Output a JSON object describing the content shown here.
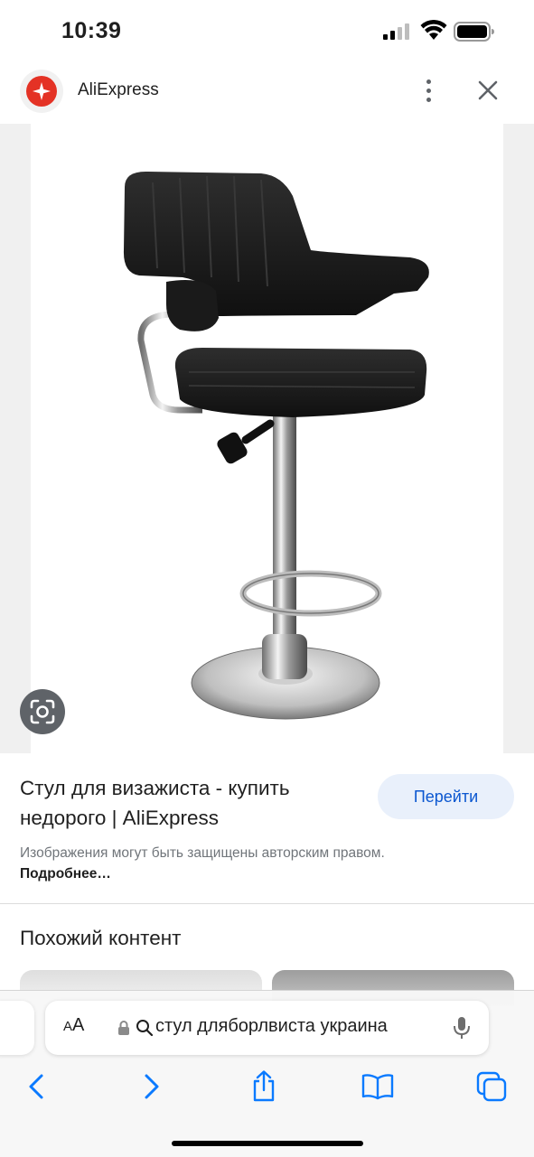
{
  "status_bar": {
    "time": "10:39"
  },
  "header": {
    "site_name": "AliExpress",
    "logo_icon": "aliexpress-logo-icon",
    "more_icon": "more-vert-icon",
    "close_icon": "close-icon"
  },
  "image": {
    "subject": "bar-stool-image",
    "lens_icon": "google-lens-icon"
  },
  "result": {
    "title": "Стул для визажиста - купить недорого | AliExpress",
    "visit_label": "Перейти",
    "copyright_text": "Изображения могут быть защищены авторским правом.",
    "more_link": "Подробнее…"
  },
  "related": {
    "heading": "Похожий контент"
  },
  "address_bar": {
    "aa_label_small": "A",
    "aa_label_large": "A",
    "url": "стул дляборлвиста украина"
  },
  "colors": {
    "accent": "#0b57d0",
    "button_bg": "#e9f0fb",
    "brand": "#e43225"
  }
}
